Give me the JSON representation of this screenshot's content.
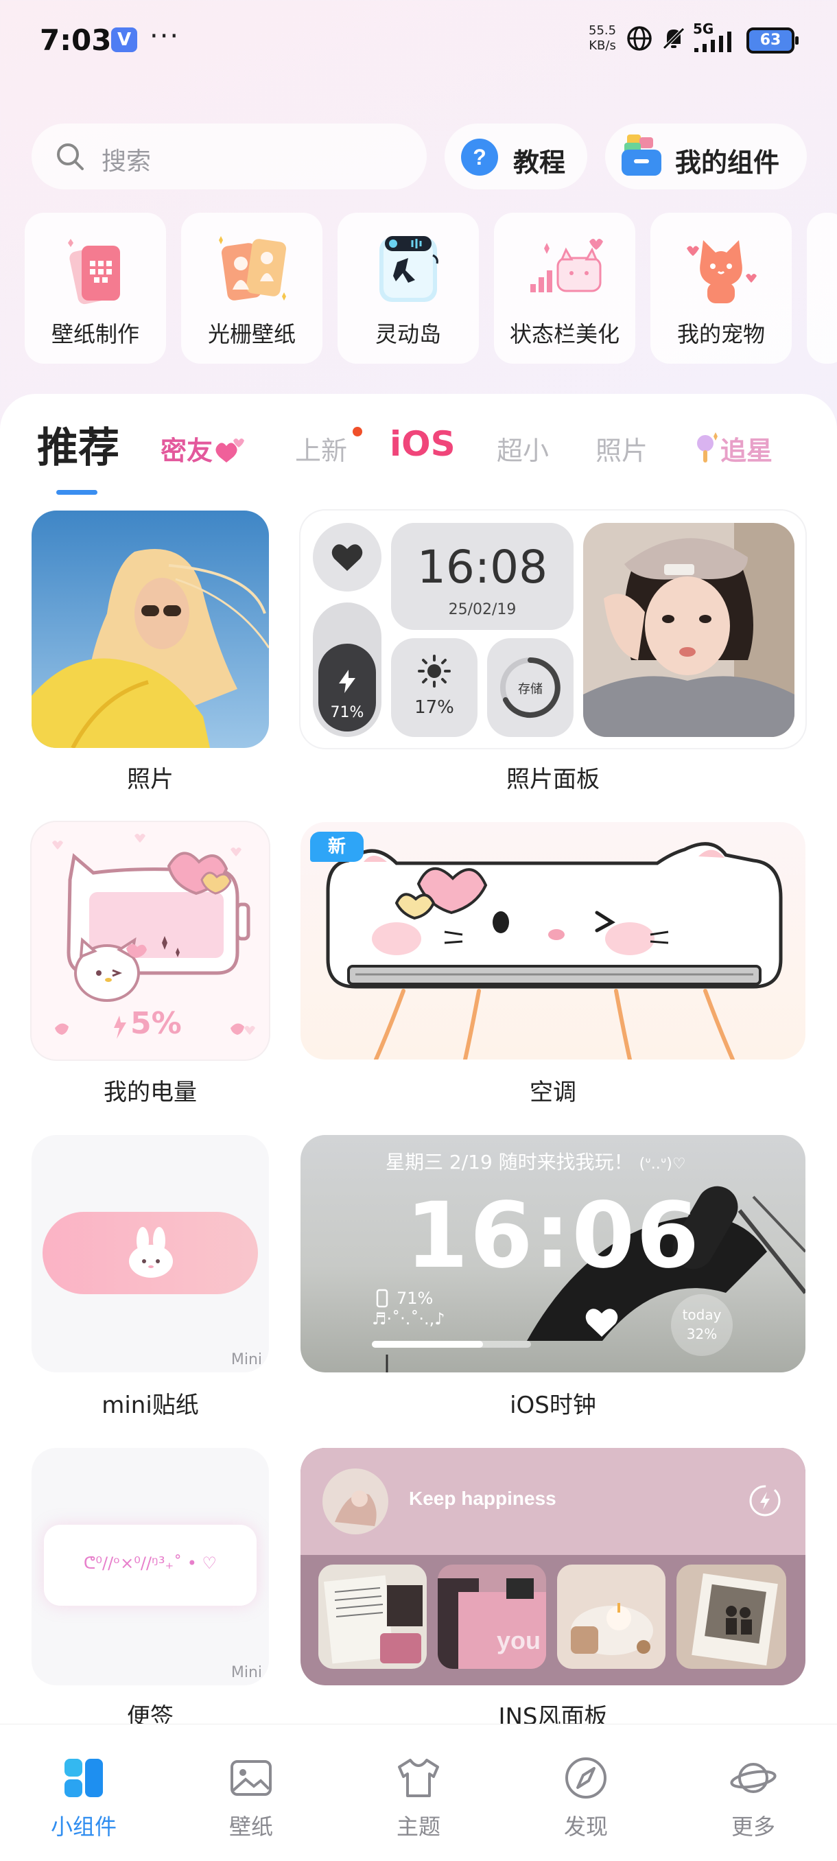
{
  "status_bar": {
    "time": "7:03",
    "badge": "V",
    "more": "···",
    "net_speed_value": "55.5",
    "net_speed_unit": "KB/s",
    "network": "5G",
    "battery": "63"
  },
  "search": {
    "placeholder": "搜索"
  },
  "header_buttons": {
    "tutorial": "教程",
    "my_widgets": "我的组件"
  },
  "tools": [
    {
      "label": "壁纸制作",
      "icon": "wallpaper-maker-icon"
    },
    {
      "label": "光栅壁纸",
      "icon": "lenticular-wallpaper-icon"
    },
    {
      "label": "灵动岛",
      "icon": "dynamic-island-icon"
    },
    {
      "label": "状态栏美化",
      "icon": "status-bar-icon"
    },
    {
      "label": "我的宠物",
      "icon": "pet-cat-icon"
    }
  ],
  "tabs": {
    "recommend": "推荐",
    "friends": "密友",
    "new": "上新",
    "ios": "iOS",
    "tiny": "超小",
    "photo": "照片",
    "idol": "追星"
  },
  "widgets": {
    "photo": {
      "label": "照片"
    },
    "photo_panel": {
      "label": "照片面板",
      "time": "16:08",
      "date": "25/02/19",
      "battery": "71%",
      "brightness": "17%",
      "storage": "存储"
    },
    "battery": {
      "label": "我的电量",
      "value": "5%"
    },
    "aircon": {
      "label": "空调",
      "badge": "新"
    },
    "mini_sticker": {
      "label": "mini贴纸",
      "tag": "Mini"
    },
    "ios_clock": {
      "label": "iOS时钟",
      "date_line": "星期三 2/19  随时来找我玩！",
      "kaomoji": "(ᐡ..ᐡ)♡",
      "time": "16:06",
      "battery": "71%",
      "music": "♬·˚‧.˚·.,♪",
      "today_label": "today",
      "today_value": "32%",
      "progress": 0.7
    },
    "note": {
      "label": "便签",
      "text": "ᕦ⁰//ᵒ×⁰//ᵑ³₊˚ • ♡",
      "tag": "Mini"
    },
    "ins_panel": {
      "label": "INS风面板",
      "title": "Keep happiness",
      "photo_text": "you"
    }
  },
  "bottom_nav": [
    {
      "label": "小组件",
      "active": true
    },
    {
      "label": "壁纸",
      "active": false
    },
    {
      "label": "主题",
      "active": false
    },
    {
      "label": "发现",
      "active": false
    },
    {
      "label": "更多",
      "active": false
    }
  ],
  "colors": {
    "accent": "#2f8df0",
    "friends_tab": "#e3589c",
    "ios_tab_start": "#f0457a",
    "ios_tab_end": "#f08a2a"
  }
}
